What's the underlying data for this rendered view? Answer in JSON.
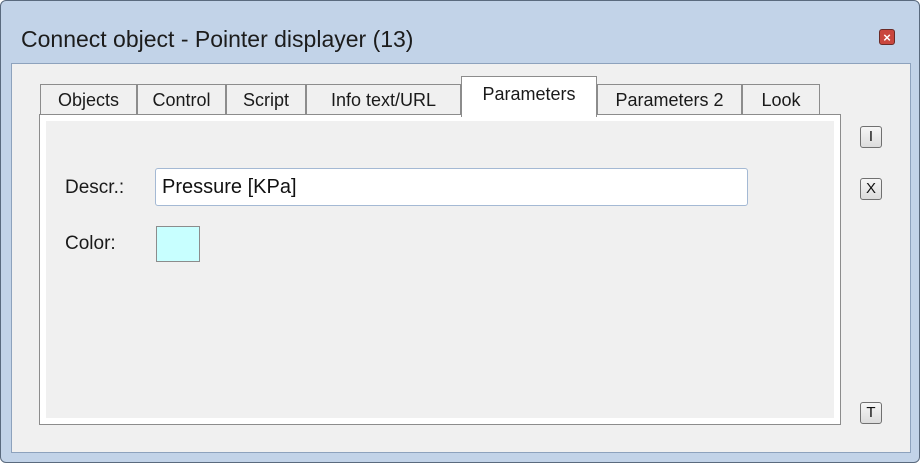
{
  "window": {
    "title": "Connect object - Pointer displayer (13)",
    "close_symbol": "×"
  },
  "tabs": [
    {
      "label": "Objects",
      "active": false
    },
    {
      "label": "Control",
      "active": false
    },
    {
      "label": "Script",
      "active": false
    },
    {
      "label": "Info text/URL",
      "active": false
    },
    {
      "label": "Parameters",
      "active": true
    },
    {
      "label": "Parameters 2",
      "active": false
    },
    {
      "label": "Look",
      "active": false
    }
  ],
  "parameters": {
    "descr_label": "Descr.:",
    "descr_value": "Pressure [KPa]",
    "color_label": "Color:",
    "color_value": "#c8ffff"
  },
  "side_buttons": {
    "i_label": "I",
    "x_label": "X",
    "t_label": "T"
  },
  "colors": {
    "titlebar": "#c2d3e8",
    "client": "#f0f0f0",
    "close": "#c9463d"
  }
}
